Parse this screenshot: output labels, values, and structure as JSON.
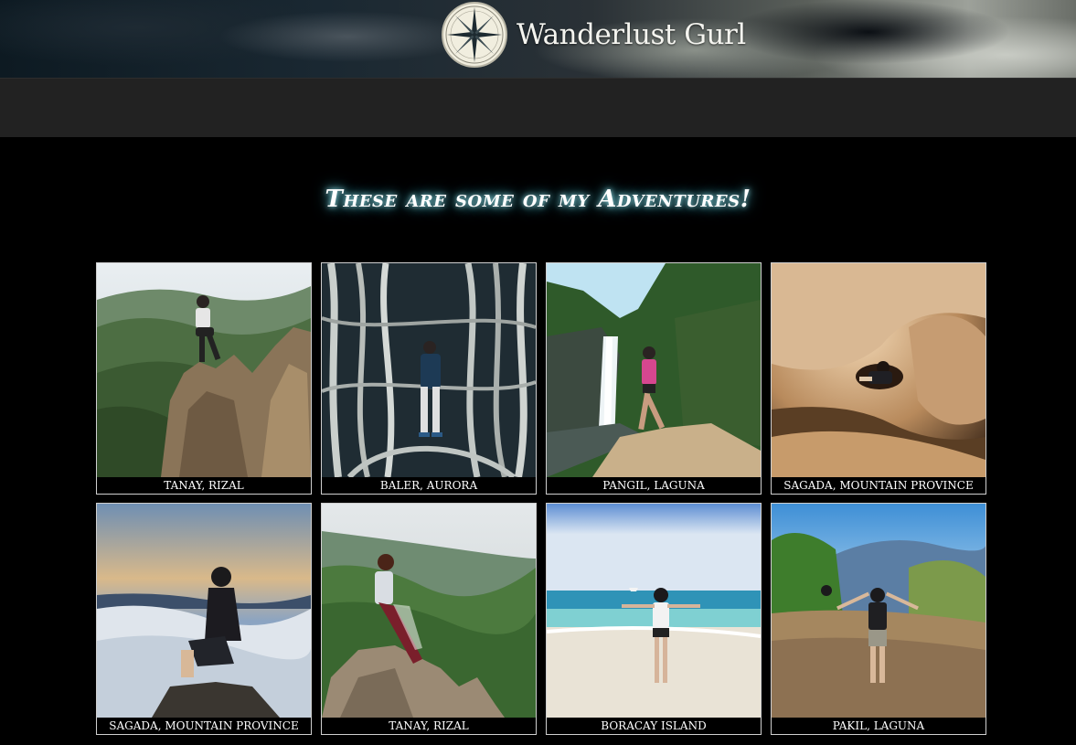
{
  "site": {
    "title": "Wanderlust Gurl",
    "logo_icon": "compass-rose-icon"
  },
  "main": {
    "heading": "These are some of my Adventures!"
  },
  "gallery": [
    {
      "caption": "TANAY, RIZAL",
      "scene": "mountain-cliff"
    },
    {
      "caption": "BALER, AURORA",
      "scene": "banyan-roots"
    },
    {
      "caption": "PANGIL, LAGUNA",
      "scene": "waterfall"
    },
    {
      "caption": "SAGADA, MOUNTAIN PROVINCE",
      "scene": "cave"
    },
    {
      "caption": "SAGADA, MOUNTAIN PROVINCE",
      "scene": "sea-of-clouds"
    },
    {
      "caption": "TANAY, RIZAL",
      "scene": "mountain-rock"
    },
    {
      "caption": "BORACAY ISLAND",
      "scene": "beach"
    },
    {
      "caption": "PAKIL, LAGUNA",
      "scene": "grassland"
    }
  ],
  "colors": {
    "page_background": "#000000",
    "nav_background": "#222222",
    "heading_glow": "#4aa8b6",
    "card_border": "#cfcfcf"
  }
}
